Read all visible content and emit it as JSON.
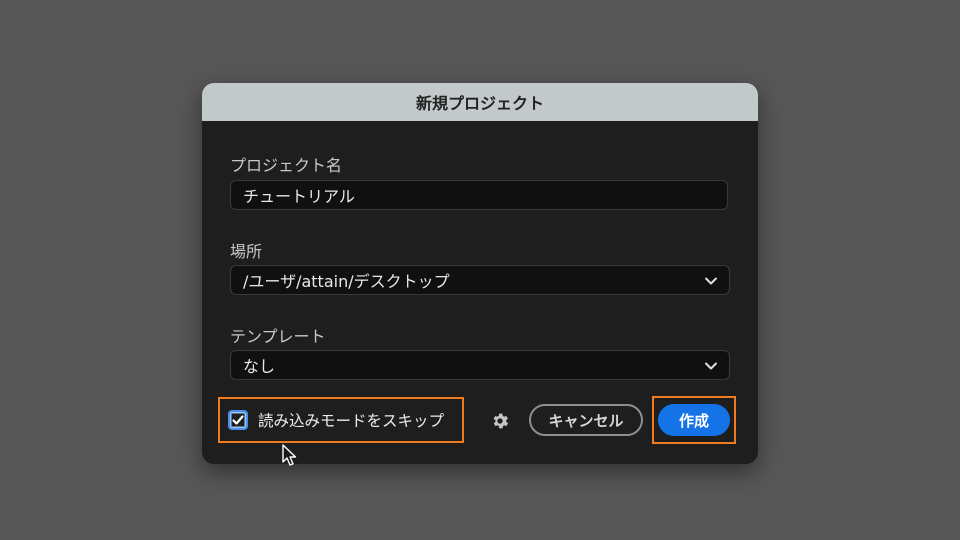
{
  "dialog": {
    "title": "新規プロジェクト",
    "project_name": {
      "label": "プロジェクト名",
      "value": "チュートリアル"
    },
    "location": {
      "label": "場所",
      "value": "/ユーザ/attain/デスクトップ"
    },
    "template": {
      "label": "テンプレート",
      "value": "なし"
    },
    "skip_import": {
      "label": "読み込みモードをスキップ",
      "checked": true
    },
    "settings_icon": "gear-icon",
    "cancel_label": "キャンセル",
    "create_label": "作成"
  },
  "colors": {
    "background": "#575757",
    "dialog": "#1e1e1e",
    "titlebar": "#c3c8cb",
    "accent": "#1473e6",
    "highlight": "#f07c22"
  }
}
